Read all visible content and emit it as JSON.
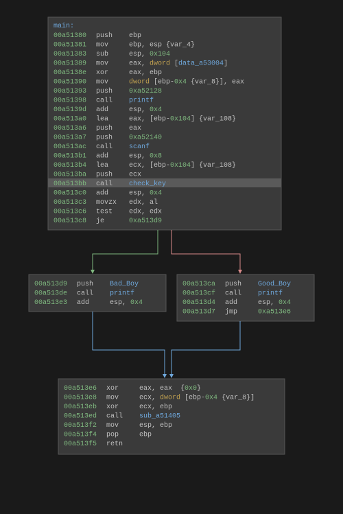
{
  "colors": {
    "bg": "#1a1a1a",
    "box": "#3a3a3a",
    "boxBorder": "#555",
    "highlight": "#5a5a5a",
    "addr": "#7fb87f",
    "func": "#6fa8dc",
    "num": "#7fb87f",
    "kw": "#c0a050"
  },
  "main": {
    "label": "main:",
    "lines": [
      {
        "addr": "00a51380",
        "op": "push",
        "args": [
          {
            "t": "ebp",
            "c": "mnem"
          }
        ]
      },
      {
        "addr": "00a51381",
        "op": "mov",
        "args": [
          {
            "t": "ebp, ",
            "c": "mnem"
          },
          {
            "t": "esp ",
            "c": "mnem"
          },
          {
            "t": "{var_4}",
            "c": "mnem"
          }
        ]
      },
      {
        "addr": "00a51383",
        "op": "sub",
        "args": [
          {
            "t": "esp, ",
            "c": "mnem"
          },
          {
            "t": "0x104",
            "c": "num"
          }
        ]
      },
      {
        "addr": "00a51389",
        "op": "mov",
        "args": [
          {
            "t": "eax, ",
            "c": "mnem"
          },
          {
            "t": "dword ",
            "c": "kw"
          },
          {
            "t": "[",
            "c": "mnem"
          },
          {
            "t": "data_a53004",
            "c": "func"
          },
          {
            "t": "]",
            "c": "mnem"
          }
        ]
      },
      {
        "addr": "00a5138e",
        "op": "xor",
        "args": [
          {
            "t": "eax, ebp",
            "c": "mnem"
          }
        ]
      },
      {
        "addr": "00a51390",
        "op": "mov",
        "args": [
          {
            "t": "dword ",
            "c": "kw"
          },
          {
            "t": "[ebp-",
            "c": "mnem"
          },
          {
            "t": "0x4 ",
            "c": "num"
          },
          {
            "t": "{var_8}], eax",
            "c": "mnem"
          }
        ]
      },
      {
        "addr": "00a51393",
        "op": "push",
        "args": [
          {
            "t": "0xa52128",
            "c": "num"
          }
        ]
      },
      {
        "addr": "00a51398",
        "op": "call",
        "args": [
          {
            "t": "printf",
            "c": "func"
          }
        ]
      },
      {
        "addr": "00a5139d",
        "op": "add",
        "args": [
          {
            "t": "esp, ",
            "c": "mnem"
          },
          {
            "t": "0x4",
            "c": "num"
          }
        ]
      },
      {
        "addr": "00a513a0",
        "op": "lea",
        "args": [
          {
            "t": "eax, [ebp-",
            "c": "mnem"
          },
          {
            "t": "0x104",
            "c": "num"
          },
          {
            "t": "] {var_108}",
            "c": "mnem"
          }
        ]
      },
      {
        "addr": "00a513a6",
        "op": "push",
        "args": [
          {
            "t": "eax",
            "c": "mnem"
          }
        ]
      },
      {
        "addr": "00a513a7",
        "op": "push",
        "args": [
          {
            "t": "0xa52140",
            "c": "num"
          }
        ]
      },
      {
        "addr": "00a513ac",
        "op": "call",
        "args": [
          {
            "t": "scanf",
            "c": "func"
          }
        ]
      },
      {
        "addr": "00a513b1",
        "op": "add",
        "args": [
          {
            "t": "esp, ",
            "c": "mnem"
          },
          {
            "t": "0x8",
            "c": "num"
          }
        ]
      },
      {
        "addr": "00a513b4",
        "op": "lea",
        "args": [
          {
            "t": "ecx, [ebp-",
            "c": "mnem"
          },
          {
            "t": "0x104",
            "c": "num"
          },
          {
            "t": "] {var_108}",
            "c": "mnem"
          }
        ]
      },
      {
        "addr": "00a513ba",
        "op": "push",
        "args": [
          {
            "t": "ecx",
            "c": "mnem"
          }
        ]
      },
      {
        "addr": "00a513bb",
        "op": "call",
        "args": [
          {
            "t": "check_key",
            "c": "func"
          }
        ],
        "highlight": true
      },
      {
        "addr": "00a513c0",
        "op": "add",
        "args": [
          {
            "t": "esp, ",
            "c": "mnem"
          },
          {
            "t": "0x4",
            "c": "num"
          }
        ]
      },
      {
        "addr": "00a513c3",
        "op": "movzx",
        "args": [
          {
            "t": "edx, al",
            "c": "mnem"
          }
        ]
      },
      {
        "addr": "00a513c6",
        "op": "test",
        "args": [
          {
            "t": "edx, edx",
            "c": "mnem"
          }
        ]
      },
      {
        "addr": "00a513c8",
        "op": "je",
        "args": [
          {
            "t": "0xa513d9",
            "c": "num"
          }
        ]
      }
    ]
  },
  "left": {
    "lines": [
      {
        "addr": "00a513d9",
        "op": "push",
        "args": [
          {
            "t": "Bad_Boy",
            "c": "func"
          }
        ]
      },
      {
        "addr": "00a513de",
        "op": "call",
        "args": [
          {
            "t": "printf",
            "c": "func"
          }
        ]
      },
      {
        "addr": "00a513e3",
        "op": "add",
        "args": [
          {
            "t": "esp, ",
            "c": "mnem"
          },
          {
            "t": "0x4",
            "c": "num"
          }
        ]
      }
    ]
  },
  "right": {
    "lines": [
      {
        "addr": "00a513ca",
        "op": "push",
        "args": [
          {
            "t": "Good_Boy",
            "c": "func"
          }
        ]
      },
      {
        "addr": "00a513cf",
        "op": "call",
        "args": [
          {
            "t": "printf",
            "c": "func"
          }
        ]
      },
      {
        "addr": "00a513d4",
        "op": "add",
        "args": [
          {
            "t": "esp, ",
            "c": "mnem"
          },
          {
            "t": "0x4",
            "c": "num"
          }
        ]
      },
      {
        "addr": "00a513d7",
        "op": "jmp",
        "args": [
          {
            "t": "0xa513e6",
            "c": "num"
          }
        ]
      }
    ]
  },
  "bottom": {
    "lines": [
      {
        "addr": "00a513e6",
        "op": "xor",
        "args": [
          {
            "t": "eax, eax  {",
            "c": "mnem"
          },
          {
            "t": "0x0",
            "c": "num"
          },
          {
            "t": "}",
            "c": "mnem"
          }
        ]
      },
      {
        "addr": "00a513e8",
        "op": "mov",
        "args": [
          {
            "t": "ecx, ",
            "c": "mnem"
          },
          {
            "t": "dword ",
            "c": "kw"
          },
          {
            "t": "[ebp-",
            "c": "mnem"
          },
          {
            "t": "0x4 ",
            "c": "num"
          },
          {
            "t": "{var_8}]",
            "c": "mnem"
          }
        ]
      },
      {
        "addr": "00a513eb",
        "op": "xor",
        "args": [
          {
            "t": "ecx, ebp",
            "c": "mnem"
          }
        ]
      },
      {
        "addr": "00a513ed",
        "op": "call",
        "args": [
          {
            "t": "sub_a51405",
            "c": "func"
          }
        ]
      },
      {
        "addr": "00a513f2",
        "op": "mov",
        "args": [
          {
            "t": "esp, ebp",
            "c": "mnem"
          }
        ]
      },
      {
        "addr": "00a513f4",
        "op": "pop",
        "args": [
          {
            "t": "ebp",
            "c": "mnem"
          }
        ]
      },
      {
        "addr": "00a513f5",
        "op": "retn",
        "args": []
      }
    ]
  }
}
